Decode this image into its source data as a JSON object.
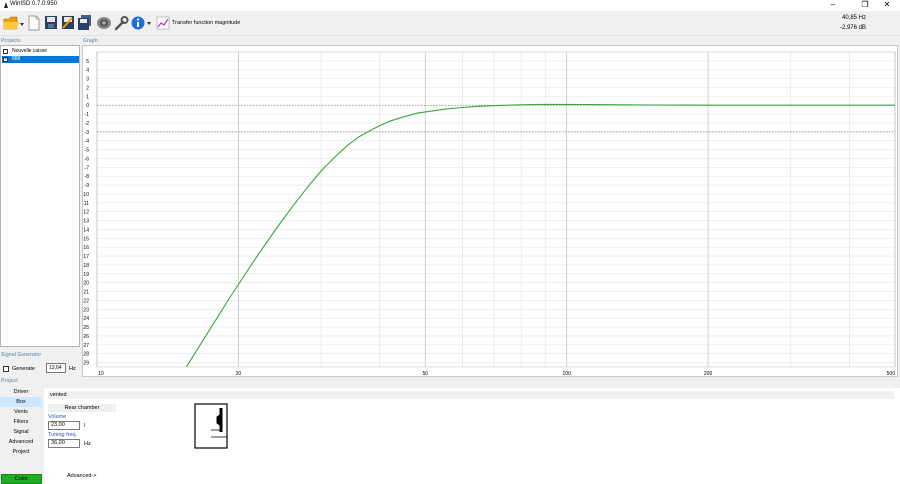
{
  "window": {
    "title": "WinISD 0.7.0.950"
  },
  "toolbar": {
    "label": "Transfer function magnitude",
    "readout_freq": "40,85 Hz",
    "readout_db": "-2,976 dB"
  },
  "sections": {
    "projects": "Projects",
    "graph": "Graph",
    "signal_generator": "Signal Generator",
    "project": "Project"
  },
  "projects": [
    {
      "name": "Nouvelle caisse",
      "checked": false,
      "selected": false
    },
    {
      "name": "888",
      "checked": true,
      "selected": true
    }
  ],
  "signal_generator": {
    "generate_label": "Generate",
    "frequency": "13,64",
    "unit": "Hz"
  },
  "nav": [
    "Driver",
    "Box",
    "Vents",
    "Filters",
    "Signal",
    "Advanced",
    "Project"
  ],
  "nav_active": "Box",
  "color_button": "Color",
  "box": {
    "type": "vented",
    "chamber_label": "Rear chamber",
    "volume_label": "Volume",
    "volume_value": "23,00",
    "volume_unit": "l",
    "tuning_label": "Tuning freq.",
    "tuning_value": "36,00",
    "tuning_unit": "Hz",
    "advanced_link": "Advanced->"
  },
  "chart_data": {
    "type": "line",
    "x_scale": "log",
    "xlim": [
      10,
      500
    ],
    "ylim": [
      -29.5,
      6
    ],
    "x_ticks": [
      10,
      20,
      50,
      100,
      200,
      500
    ],
    "x_minor": [
      30,
      40,
      60,
      70,
      80,
      90,
      300,
      400
    ],
    "y_ticks": [
      5,
      4,
      3,
      2,
      1,
      0,
      -1,
      -2,
      -3,
      -4,
      -5,
      -6,
      -7,
      -8,
      -9,
      -10,
      -11,
      -12,
      -13,
      -14,
      -15,
      -16,
      -17,
      -18,
      -19,
      -20,
      -21,
      -22,
      -23,
      -24,
      -25,
      -26,
      -27,
      -28,
      -29
    ],
    "reference_lines": [
      0,
      -3
    ],
    "grid": true,
    "series": [
      {
        "color": "#3aa53a",
        "x": [
          15.5,
          16,
          17,
          18,
          19,
          20,
          22,
          24,
          26,
          28,
          30,
          32,
          34,
          36,
          38,
          40,
          42,
          45,
          48,
          50,
          55,
          60,
          65,
          70,
          75,
          80,
          85,
          90,
          95,
          100,
          110,
          120,
          130,
          150,
          175,
          200,
          250,
          300,
          400,
          500
        ],
        "y": [
          -29.5,
          -28.3,
          -26.1,
          -24.0,
          -22.0,
          -20.2,
          -16.9,
          -14.0,
          -11.5,
          -9.3,
          -7.4,
          -5.9,
          -4.6,
          -3.6,
          -2.9,
          -2.3,
          -1.8,
          -1.3,
          -0.9,
          -0.75,
          -0.45,
          -0.25,
          -0.12,
          -0.05,
          0.0,
          0.05,
          0.08,
          0.1,
          0.1,
          0.1,
          0.08,
          0.06,
          0.05,
          0.03,
          0.02,
          0.01,
          0.0,
          0.0,
          0.0,
          0.0
        ]
      }
    ]
  }
}
